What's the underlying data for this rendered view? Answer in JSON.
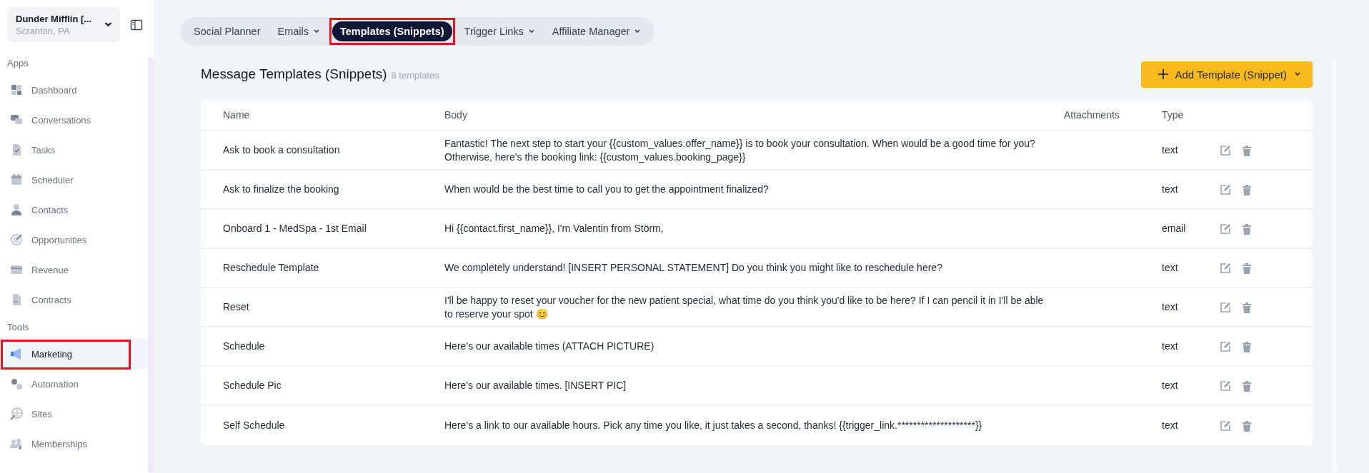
{
  "account": {
    "name": "Dunder Mifflin [...",
    "location": "Scranton, PA"
  },
  "sidebar": {
    "sections": [
      {
        "title": "Apps",
        "items": [
          {
            "label": "Dashboard",
            "selected": false,
            "highlighted": false
          },
          {
            "label": "Conversations",
            "selected": false,
            "highlighted": false
          },
          {
            "label": "Tasks",
            "selected": false,
            "highlighted": false
          },
          {
            "label": "Scheduler",
            "selected": false,
            "highlighted": false
          },
          {
            "label": "Contacts",
            "selected": false,
            "highlighted": false
          },
          {
            "label": "Opportunities",
            "selected": false,
            "highlighted": false
          },
          {
            "label": "Revenue",
            "selected": false,
            "highlighted": false
          },
          {
            "label": "Contracts",
            "selected": false,
            "highlighted": false
          }
        ]
      },
      {
        "title": "Tools",
        "items": [
          {
            "label": "Marketing",
            "selected": true,
            "highlighted": true
          },
          {
            "label": "Automation",
            "selected": false,
            "highlighted": false
          },
          {
            "label": "Sites",
            "selected": false,
            "highlighted": false
          },
          {
            "label": "Memberships",
            "selected": false,
            "highlighted": false
          }
        ]
      }
    ]
  },
  "tabs": [
    {
      "label": "Social Planner",
      "dropdown": false,
      "selected": false,
      "highlighted": false
    },
    {
      "label": "Emails",
      "dropdown": true,
      "selected": false,
      "highlighted": false
    },
    {
      "label": "Templates (Snippets)",
      "dropdown": false,
      "selected": true,
      "highlighted": true
    },
    {
      "label": "Trigger Links",
      "dropdown": true,
      "selected": false,
      "highlighted": false
    },
    {
      "label": "Affiliate Manager",
      "dropdown": true,
      "selected": false,
      "highlighted": false
    }
  ],
  "page": {
    "title": "Message Templates (Snippets)",
    "count": "8 templates",
    "add_button": "Add Template (Snippet)"
  },
  "table": {
    "columns": [
      "Name",
      "Body",
      "Attachments",
      "Type"
    ],
    "rows": [
      {
        "name": "Ask to book a consultation",
        "body": "Fantastic! The next step to start your {{custom_values.offer_name}} is to book your consultation. When would be a good time for you? Otherwise, here's the booking link: {{custom_values.booking_page}}",
        "type": "text"
      },
      {
        "name": "Ask to finalize the booking",
        "body": "When would be the best time to call you to get the appointment finalized?",
        "type": "text"
      },
      {
        "name": "Onboard 1 - MedSpa - 1st Email",
        "body": "Hi {{contact.first_name}},   I'm Valentin from Störm,",
        "type": "email"
      },
      {
        "name": "Reschedule Template",
        "body": "We completely understand! [INSERT PERSONAL STATEMENT] Do you think you might like to reschedule here?",
        "type": "text"
      },
      {
        "name": "Reset",
        "body": "I'll be happy to reset your voucher for the new patient special, what time do you think you'd like to be here? If I can pencil it in I'll be able to reserve your spot 😊",
        "type": "text"
      },
      {
        "name": "Schedule",
        "body": "Here’s our available times (ATTACH PICTURE)",
        "type": "text"
      },
      {
        "name": "Schedule Pic",
        "body": "Here's our available times. [INSERT PIC]",
        "type": "text"
      },
      {
        "name": "Self Schedule",
        "body": "Here’s a link to our available hours. Pick any time you like, it just takes a second, thanks! {{trigger_link.********************}}",
        "type": "text"
      }
    ]
  }
}
